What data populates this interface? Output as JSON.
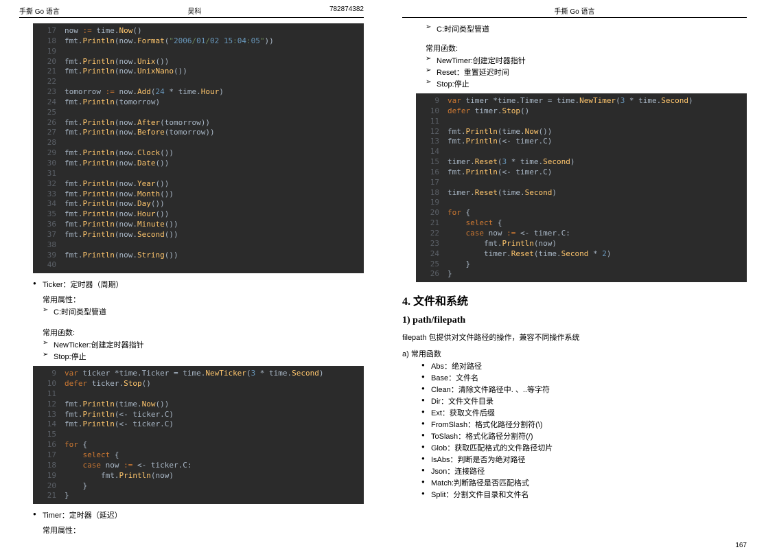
{
  "left_header": {
    "l": "手撕 Go 语言",
    "c": "吴科",
    "r": "782874382"
  },
  "right_header": {
    "c": "手撕 Go 语言"
  },
  "page_num": "167",
  "code1_start": 17,
  "code1": [
    "now := time.Now()",
    "fmt.Println(now.Format(\"2006/01/02 15:04:05\"))",
    "",
    "fmt.Println(now.Unix())",
    "fmt.Println(now.UnixNano())",
    "",
    "tomorrow := now.Add(24 * time.Hour)",
    "fmt.Println(tomorrow)",
    "",
    "fmt.Println(now.After(tomorrow))",
    "fmt.Println(now.Before(tomorrow))",
    "",
    "fmt.Println(now.Clock())",
    "fmt.Println(now.Date())",
    "",
    "fmt.Println(now.Year())",
    "fmt.Println(now.Month())",
    "fmt.Println(now.Day())",
    "fmt.Println(now.Hour())",
    "fmt.Println(now.Minute())",
    "fmt.Println(now.Second())",
    "",
    "fmt.Println(now.String())",
    ""
  ],
  "ticker_title": "Ticker：定时器（周期）",
  "ticker_attr": "常用属性：",
  "ticker_attr_items": [
    "C:时间类型管道"
  ],
  "ticker_fn": "常用函数:",
  "ticker_fn_items": [
    "NewTicker:创建定时器指针",
    "Stop:停止"
  ],
  "code2_start": 9,
  "code2": [
    "var ticker *time.Ticker = time.NewTicker(3 * time.Second)",
    "defer ticker.Stop()",
    "",
    "fmt.Println(time.Now())",
    "fmt.Println(<- ticker.C)",
    "fmt.Println(<- ticker.C)",
    "",
    "for {",
    "    select {",
    "    case now := <- ticker.C:",
    "        fmt.Println(now)",
    "    }",
    "}"
  ],
  "timer_title": "Timer：定时器（延迟）",
  "timer_attr": "常用属性：",
  "timer_attr_items": [
    "C:时间类型管道"
  ],
  "timer_fn": "常用函数:",
  "timer_fn_items": [
    "NewTimer:创建定时器指针",
    "Reset：重置延迟时间",
    "Stop:停止"
  ],
  "code3_start": 9,
  "code3": [
    "var timer *time.Timer = time.NewTimer(3 * time.Second)",
    "defer timer.Stop()",
    "",
    "fmt.Println(time.Now())",
    "fmt.Println(<- timer.C)",
    "",
    "timer.Reset(3 * time.Second)",
    "fmt.Println(<- timer.C)",
    "",
    "timer.Reset(time.Second)",
    "",
    "for {",
    "    select {",
    "    case now := <- timer.C:",
    "        fmt.Println(now)",
    "        timer.Reset(time.Second * 2)",
    "    }",
    "}"
  ],
  "section4": "4. 文件和系统",
  "sub1": "1) path/filepath",
  "filepath_desc": "filepath 包提供对文件路径的操作，兼容不同操作系统",
  "a_label": "a)  常用函数",
  "filepath_items": [
    "Abs：绝对路径",
    "Base：文件名",
    "Clean：清除文件路径中. 、..等字符",
    "Dir：文件文件目录",
    "Ext：获取文件后缀",
    "FromSlash：格式化路径分割符(\\)",
    "ToSlash：格式化路径分割符(/)",
    "Glob：获取匹配格式的文件路径切片",
    "IsAbs：判断是否为绝对路径",
    "Json：连接路径",
    "Match:判断路径是否匹配格式",
    "Split：分割文件目录和文件名"
  ]
}
